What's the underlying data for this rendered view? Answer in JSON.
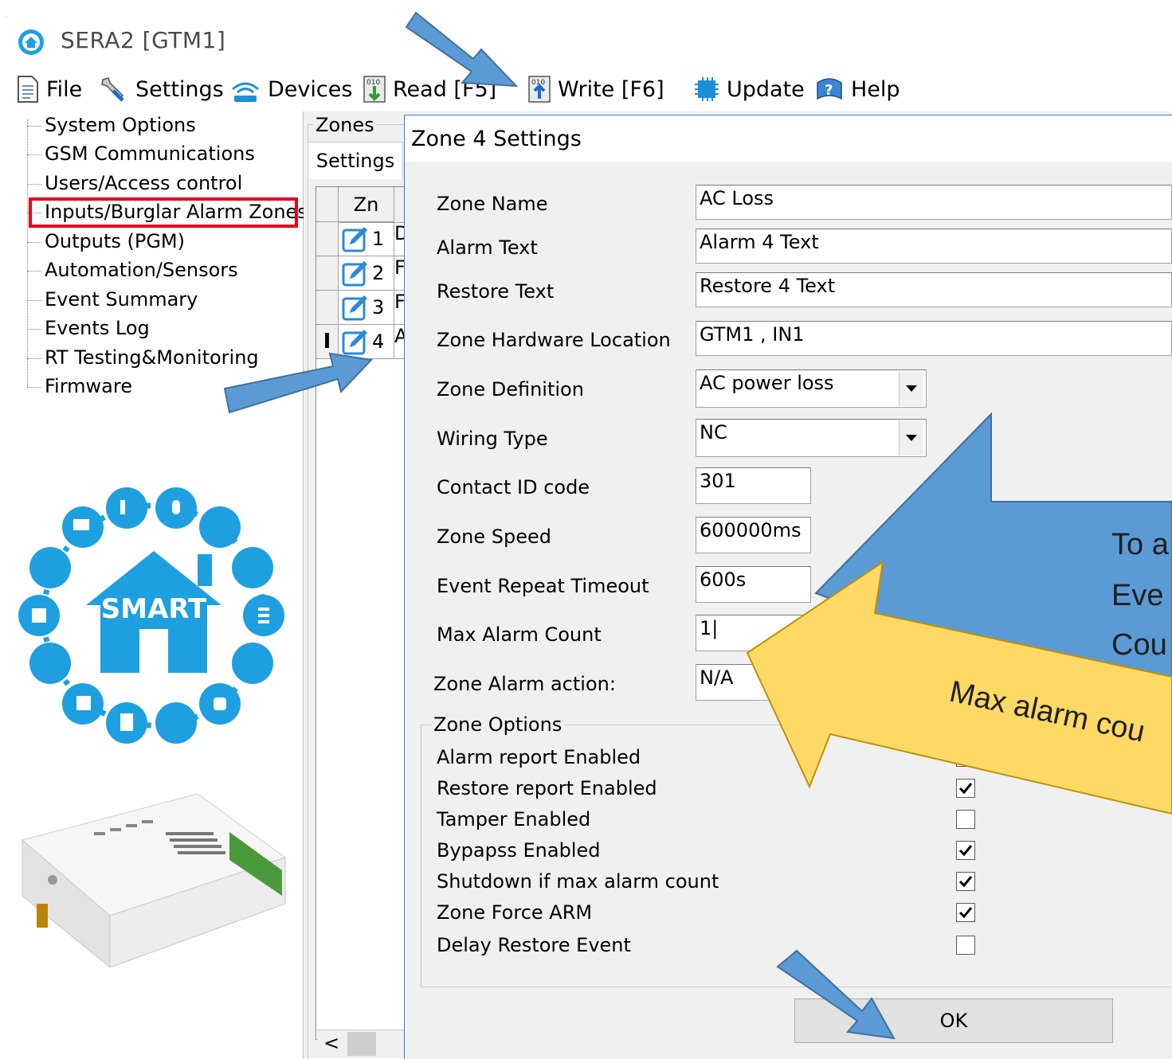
{
  "window": {
    "title": "SERA2 [GTM1]"
  },
  "menu": [
    {
      "label": "File",
      "icon": "file-icon"
    },
    {
      "label": "Settings",
      "icon": "wrench-icon"
    },
    {
      "label": "Devices",
      "icon": "wifi-icon"
    },
    {
      "label": "Read [F5]",
      "icon": "read-icon"
    },
    {
      "label": "Write [F6]",
      "icon": "write-icon"
    },
    {
      "label": "Update",
      "icon": "chip-icon"
    },
    {
      "label": "Help",
      "icon": "help-icon"
    }
  ],
  "tree": [
    "System Options",
    "GSM Communications",
    "Users/Access control",
    "Inputs/Burglar Alarm Zones",
    "Outputs (PGM)",
    "Automation/Sensors",
    "Event Summary",
    "Events Log",
    "RT Testing&Monitoring",
    "Firmware"
  ],
  "tree_selected": "Inputs/Burglar Alarm Zones",
  "branding": {
    "smart_label": "SMART"
  },
  "zones_panel": {
    "group_label": "Zones",
    "tab_label": "Settings",
    "column_header": "Zn",
    "rows": [
      {
        "num": "1",
        "next": "D"
      },
      {
        "num": "2",
        "next": "F"
      },
      {
        "num": "3",
        "next": "F"
      },
      {
        "num": "4",
        "next": "A"
      }
    ],
    "scroll_left": "<"
  },
  "dialog": {
    "title": "Zone 4 Settings",
    "fields": {
      "zone_name": {
        "label": "Zone Name",
        "value": "AC Loss"
      },
      "alarm_text": {
        "label": "Alarm Text",
        "value": "Alarm 4 Text"
      },
      "restore_text": {
        "label": "Restore Text",
        "value": "Restore 4 Text"
      },
      "hw_location": {
        "label": "Zone Hardware Location",
        "value": "GTM1 , IN1"
      },
      "zone_definition": {
        "label": "Zone Definition",
        "value": "AC power loss"
      },
      "wiring_type": {
        "label": "Wiring Type",
        "value": "NC"
      },
      "contact_id": {
        "label": "Contact ID code",
        "value": "301"
      },
      "zone_speed": {
        "label": "Zone Speed",
        "value": "600000ms"
      },
      "event_repeat": {
        "label": "Event Repeat Timeout",
        "value": "600s"
      },
      "max_alarm": {
        "label": "Max Alarm Count",
        "value": "1|"
      },
      "zone_alarm_action": {
        "label": "Zone Alarm action:",
        "value": "N/A"
      }
    },
    "options_group": "Zone Options",
    "options": [
      {
        "label": "Alarm report Enabled",
        "checked": true
      },
      {
        "label": "Restore report Enabled",
        "checked": true
      },
      {
        "label": "Tamper Enabled",
        "checked": false
      },
      {
        "label": "Bypapss Enabled",
        "checked": true
      },
      {
        "label": "Shutdown if max alarm count",
        "checked": true
      },
      {
        "label": "Zone Force ARM",
        "checked": true
      },
      {
        "label": "Delay Restore Event",
        "checked": false
      }
    ],
    "ok_label": "OK"
  },
  "callouts": {
    "blue_lines": [
      "To a",
      "Eve",
      "Cou"
    ],
    "yellow_text": "Max alarm cou",
    "blue_color": "#5b9bd5",
    "yellow_color": "#ffd966"
  }
}
